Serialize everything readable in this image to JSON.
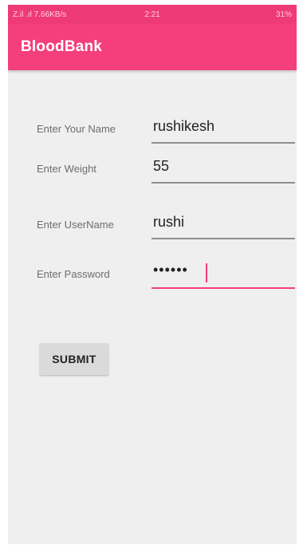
{
  "status_bar": {
    "left": "Z.il .ıl 7.66KB/s",
    "time": "2:21",
    "right": "31%"
  },
  "app_bar": {
    "title": "BloodBank"
  },
  "form": {
    "name": {
      "label": "Enter Your Name",
      "value": "rushikesh"
    },
    "weight": {
      "label": "Enter Weight",
      "value": "55"
    },
    "username": {
      "label": "Enter UserName",
      "value": "rushi"
    },
    "password": {
      "label": "Enter Password",
      "masked_value": "••••••"
    }
  },
  "submit_label": "SUBMIT",
  "colors": {
    "accent": "#f43f7c",
    "background": "#efefef",
    "button": "#dadada"
  }
}
